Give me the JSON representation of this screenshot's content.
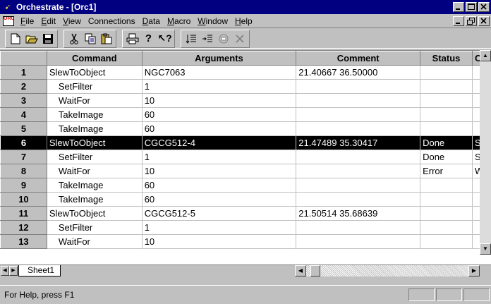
{
  "window": {
    "title": "Orchestrate - [Orc1]",
    "app_icon": "orchestrate-app-icon"
  },
  "menu": {
    "items": [
      "File",
      "Edit",
      "View",
      "Connections",
      "Data",
      "Macro",
      "Window",
      "Help"
    ],
    "accelerators": [
      "F",
      "E",
      "V",
      "C",
      "D",
      "M",
      "W",
      "H"
    ]
  },
  "toolbar": {
    "groups": [
      [
        "new-icon",
        "open-icon",
        "save-icon"
      ],
      [
        "cut-icon",
        "copy-icon",
        "paste-icon"
      ],
      [
        "print-icon",
        "help-icon",
        "context-help-icon"
      ],
      [
        "insert-rows-icon",
        "insert-sub-icon",
        "record-icon",
        "delete-icon"
      ]
    ]
  },
  "grid": {
    "columns": [
      "Command",
      "Arguments",
      "Comment",
      "Status",
      "C"
    ],
    "selected_row": 6,
    "rows": [
      {
        "num": "1",
        "command": "SlewToObject",
        "indent": false,
        "arguments": "NGC7063",
        "comment": "21.40667  36.50000",
        "status": "",
        "extra": ""
      },
      {
        "num": "2",
        "command": "SetFilter",
        "indent": true,
        "arguments": "1",
        "comment": "",
        "status": "",
        "extra": ""
      },
      {
        "num": "3",
        "command": "WaitFor",
        "indent": true,
        "arguments": "10",
        "comment": "",
        "status": "",
        "extra": ""
      },
      {
        "num": "4",
        "command": "TakeImage",
        "indent": true,
        "arguments": "60",
        "comment": "",
        "status": "",
        "extra": ""
      },
      {
        "num": "5",
        "command": "TakeImage",
        "indent": true,
        "arguments": "60",
        "comment": "",
        "status": "",
        "extra": ""
      },
      {
        "num": "6",
        "command": "SlewToObject",
        "indent": false,
        "arguments": "CGCG512-4",
        "comment": "21.47489  35.30417",
        "status": "Done",
        "extra": "Sl"
      },
      {
        "num": "7",
        "command": "SetFilter",
        "indent": true,
        "arguments": "1",
        "comment": "",
        "status": "Done",
        "extra": "Se"
      },
      {
        "num": "8",
        "command": "WaitFor",
        "indent": true,
        "arguments": "10",
        "comment": "",
        "status": "Error",
        "extra": "W"
      },
      {
        "num": "9",
        "command": "TakeImage",
        "indent": true,
        "arguments": "60",
        "comment": "",
        "status": "",
        "extra": ""
      },
      {
        "num": "10",
        "command": "TakeImage",
        "indent": true,
        "arguments": "60",
        "comment": "",
        "status": "",
        "extra": ""
      },
      {
        "num": "11",
        "command": "SlewToObject",
        "indent": false,
        "arguments": "CGCG512-5",
        "comment": "21.50514  35.68639",
        "status": "",
        "extra": ""
      },
      {
        "num": "12",
        "command": "SetFilter",
        "indent": true,
        "arguments": "1",
        "comment": "",
        "status": "",
        "extra": ""
      },
      {
        "num": "13",
        "command": "WaitFor",
        "indent": true,
        "arguments": "10",
        "comment": "",
        "status": "",
        "extra": ""
      }
    ]
  },
  "sheet_tabs": [
    "Sheet1"
  ],
  "statusbar": {
    "message": "For Help, press F1"
  }
}
